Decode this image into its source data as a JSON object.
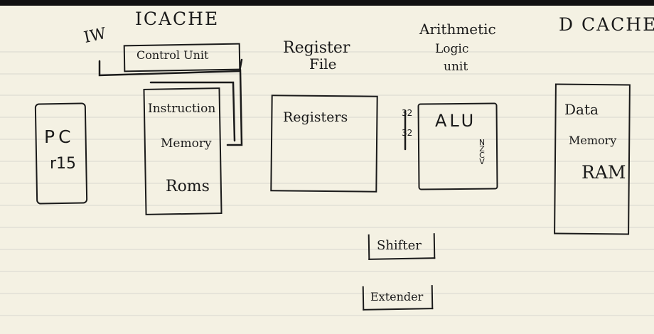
{
  "notes": {
    "headings": {
      "iw": "IW",
      "icache": "ICACHE",
      "register_file_line1": "Register",
      "register_file_line2": "File",
      "alu_heading_line1": "Arithmetic",
      "alu_heading_line2": "Logic",
      "alu_heading_line3": "unit",
      "dcache": "D CACHE"
    },
    "blocks": {
      "pc": "PC",
      "r15": "r15",
      "control_unit": "Control Unit",
      "instruction": "Instruction",
      "memory": "Memory",
      "roms": "Roms",
      "registers": "Registers",
      "bus_width_a": "32",
      "bus_width_b": "32",
      "alu": "ALU",
      "flags": [
        "N",
        "Z",
        "C",
        "V"
      ],
      "data": "Data",
      "data_memory": "Memory",
      "ram": "RAM",
      "shifter": "Shifter",
      "extender": "Extender"
    }
  }
}
